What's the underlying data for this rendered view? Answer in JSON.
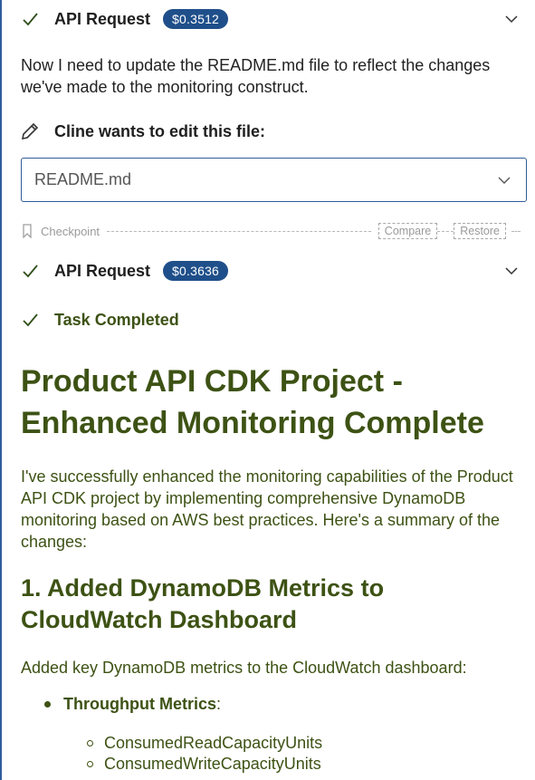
{
  "api_request_1": {
    "title": "API Request",
    "cost": "$0.3512"
  },
  "message_1": "Now I need to update the README.md file to reflect the changes we've made to the monitoring construct.",
  "edit_prompt": "Cline wants to edit this file:",
  "file_name": "README.md",
  "checkpoint": {
    "label": "Checkpoint",
    "compare": "Compare",
    "restore": "Restore"
  },
  "api_request_2": {
    "title": "API Request",
    "cost": "$0.3636"
  },
  "task_status": "Task Completed",
  "result": {
    "heading": "Product API CDK Project - Enhanced Monitoring Complete",
    "intro": "I've successfully enhanced the monitoring capabilities of the Product API CDK project by implementing comprehensive DynamoDB monitoring based on AWS best practices. Here's a summary of the changes:",
    "section1_heading": "1. Added DynamoDB Metrics to CloudWatch Dashboard",
    "section1_text": "Added key DynamoDB metrics to the CloudWatch dashboard:",
    "bullet1_label": "Throughput Metrics",
    "bullet1_colon": ":",
    "bullet1_items": [
      "ConsumedReadCapacityUnits",
      "ConsumedWriteCapacityUnits"
    ]
  },
  "colors": {
    "badge": "#1f4f8a",
    "accent_green": "#3d5214",
    "border_blue": "#2f5d9a"
  },
  "icons": [
    "check-icon",
    "chevron-down-icon",
    "pencil-icon",
    "bookmark-icon"
  ]
}
